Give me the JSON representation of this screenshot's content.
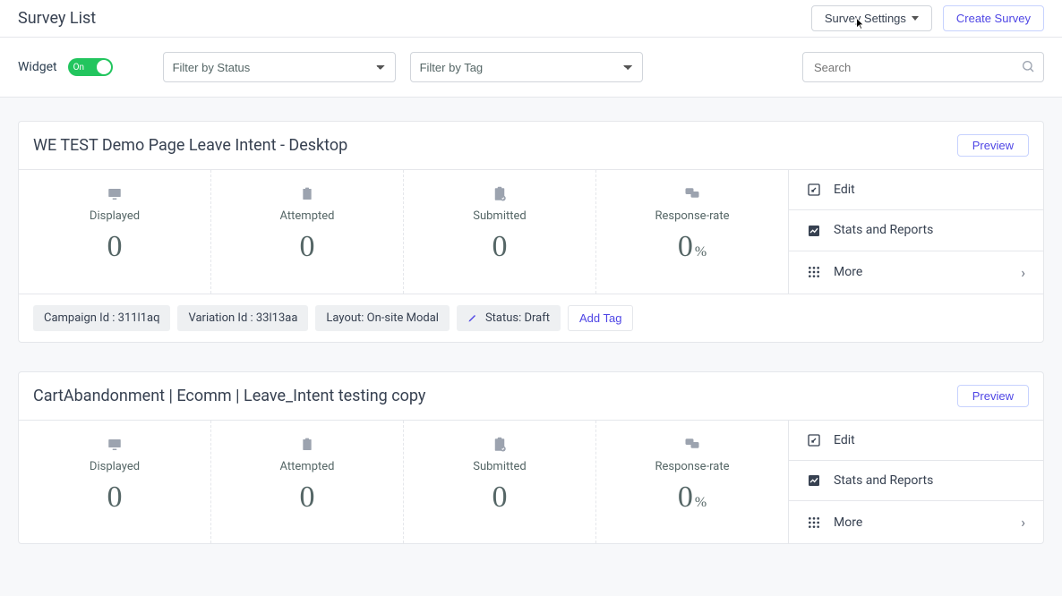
{
  "header": {
    "title": "Survey List",
    "settings_label": "Survey Settings",
    "create_label": "Create Survey"
  },
  "filters": {
    "widget_label": "Widget",
    "toggle_label": "On",
    "status_placeholder": "Filter by Status",
    "tag_placeholder": "Filter by Tag",
    "search_placeholder": "Search"
  },
  "actions": {
    "preview": "Preview",
    "edit": "Edit",
    "stats": "Stats and Reports",
    "more": "More"
  },
  "metric_labels": {
    "displayed": "Displayed",
    "attempted": "Attempted",
    "submitted": "Submitted",
    "response": "Response-rate"
  },
  "surveys": [
    {
      "title": "WE TEST Demo Page Leave Intent - Desktop",
      "displayed": "0",
      "attempted": "0",
      "submitted": "0",
      "response": "0",
      "tags": {
        "campaign": "Campaign Id : 311l1aq",
        "variation": "Variation Id : 33l13aa",
        "layout": "Layout: On-site Modal",
        "status": "Status: Draft"
      },
      "add_tag": "Add Tag"
    },
    {
      "title": "CartAbandonment | Ecomm | Leave_Intent testing copy",
      "displayed": "0",
      "attempted": "0",
      "submitted": "0",
      "response": "0"
    }
  ]
}
